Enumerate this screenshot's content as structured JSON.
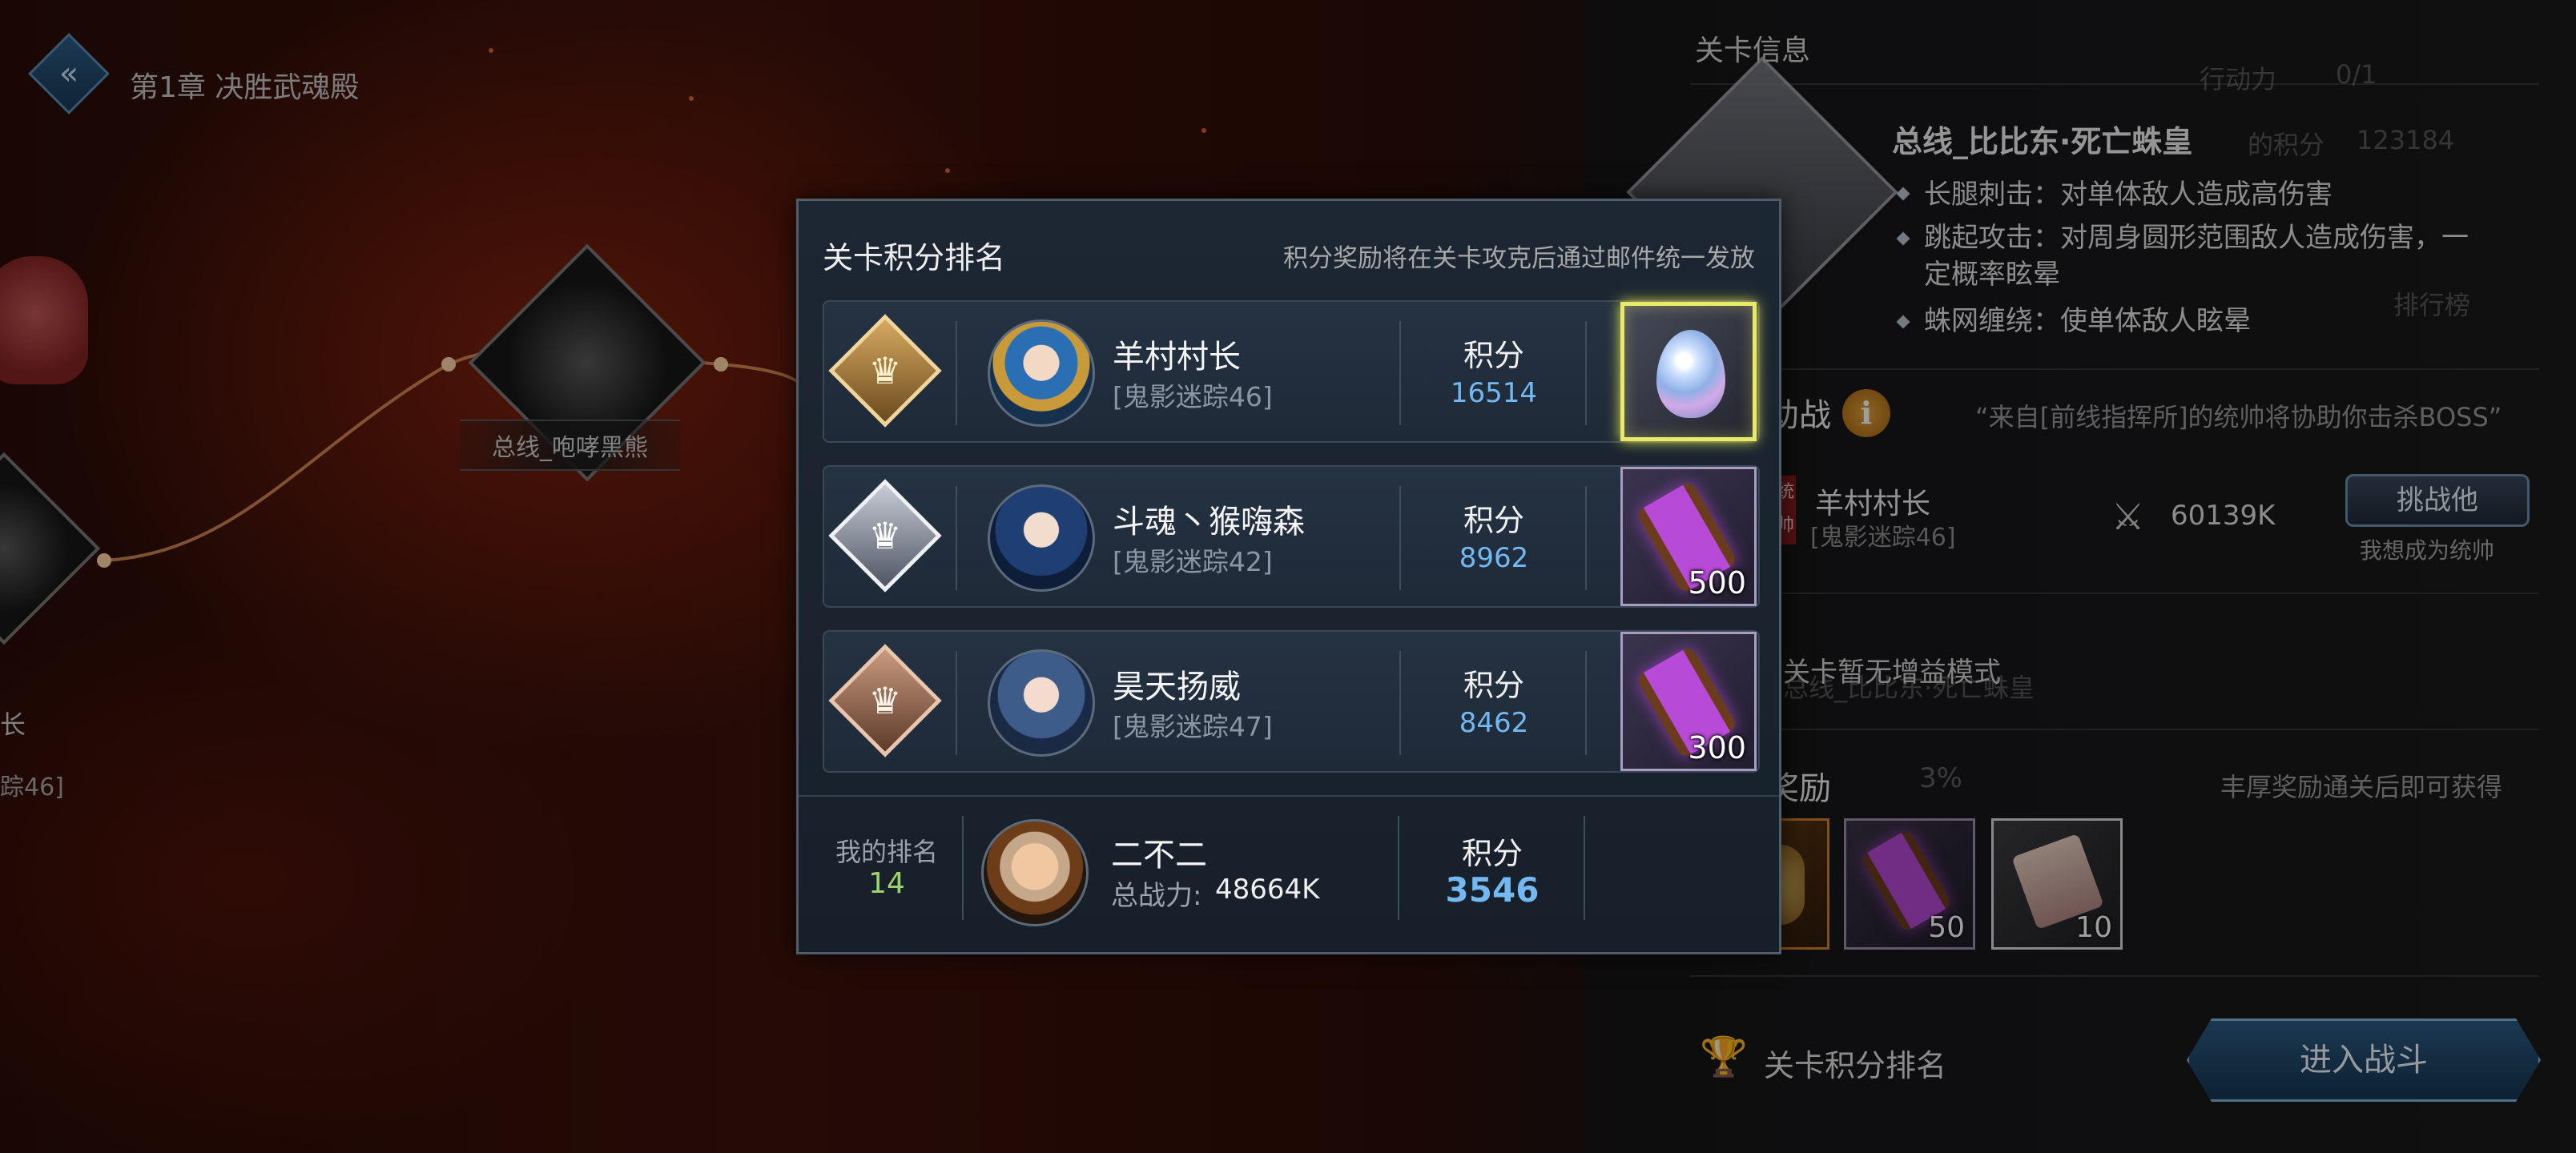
{
  "chapter": {
    "title": "第1章 决胜武魂殿"
  },
  "map": {
    "boss_node_label": "总线_咆哮黑熊",
    "left_fragment_1": "长",
    "left_fragment_2": "踪46]"
  },
  "stage_info": {
    "title": "关卡信息",
    "boss_name": "总线_比比东·死亡蛛皇",
    "skills": [
      "长腿刺击：对单体敌人造成高伤害",
      "跳起攻击：对周身圆形范围敌人造成伤害，一定概率眩晕",
      "蛛网缠绕：使单体敌人眩晕"
    ],
    "ghost_action_label": "行动力",
    "ghost_action_value": "0/1",
    "ghost_score_label": "的积分",
    "ghost_score_value": "123184",
    "ghost_leaderboard": "排行榜",
    "assist": {
      "title": "助战",
      "info_icon": "i",
      "quote": "“来自[前线指挥所]的统帅将协助你击杀BOSS”",
      "tag": "统帅",
      "name": "羊村村长",
      "guild": "[鬼影迷踪46]",
      "power": "60139K",
      "challenge_button": "挑战他",
      "challenge_sub": "我想成为统帅"
    },
    "no_buff": "关卡暂无增益模式",
    "ghost_buff": "总线_比比东·死亡蛛皇",
    "rewards": {
      "title": "奖励",
      "ghost_pct": "3%",
      "note": "丰厚奖励通关后即可获得",
      "items": [
        {
          "icon": "golden-figure-icon",
          "count": ""
        },
        {
          "icon": "purple-scroll-icon",
          "count": "50"
        },
        {
          "icon": "parchment-scroll-icon",
          "count": "10"
        }
      ]
    },
    "rank_link": "关卡积分排名",
    "enter_button": "进入战斗"
  },
  "popup": {
    "title": "关卡积分排名",
    "note": "积分奖励将在关卡攻克后通过邮件统一发放",
    "rows": [
      {
        "badge": "gold",
        "name": "羊村村长",
        "guild": "[鬼影迷踪46]",
        "score_label": "积分",
        "score": "16514",
        "reward_icon": "dragon-egg-icon",
        "reward_count": ""
      },
      {
        "badge": "silver",
        "name": "斗魂丶猴嗨森",
        "guild": "[鬼影迷踪42]",
        "score_label": "积分",
        "score": "8962",
        "reward_icon": "purple-scroll-icon",
        "reward_count": "500"
      },
      {
        "badge": "bronze",
        "name": "昊天扬威",
        "guild": "[鬼影迷踪47]",
        "score_label": "积分",
        "score": "8462",
        "reward_icon": "purple-scroll-icon",
        "reward_count": "300"
      }
    ],
    "mine": {
      "rank_label": "我的排名",
      "rank": "14",
      "name": "二不二",
      "power_label": "总战力:",
      "power": "48664K",
      "score_label": "积分",
      "score": "3546"
    }
  },
  "colors": {
    "score_blue": "#73b8f0",
    "rank_green": "#9bd66a",
    "glow_yellow": "#e9ea6a"
  }
}
